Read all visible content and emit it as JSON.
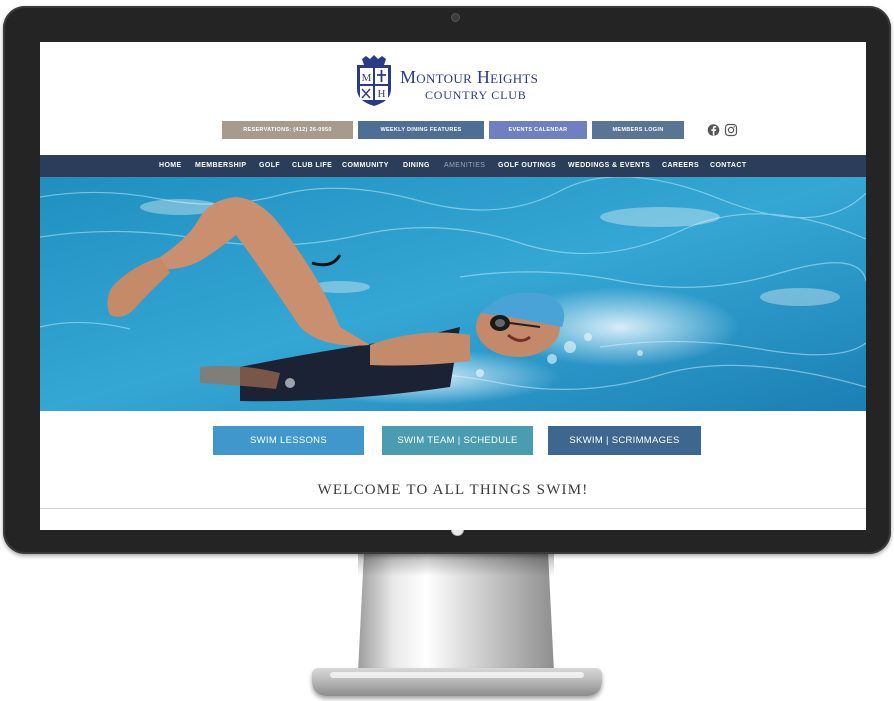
{
  "club": {
    "crest_letters": [
      "M",
      "H"
    ],
    "name_line1": "Montour Heights",
    "name_line2": "COUNTRY CLUB"
  },
  "top_buttons": [
    {
      "label": "RESERVATIONS: (412) 26-0950",
      "color": "#a89a8c"
    },
    {
      "label": "WEEKLY DINING FEATURES",
      "color": "#4f6e96"
    },
    {
      "label": "EVENTS CALENDAR",
      "color": "#6f7fbf"
    },
    {
      "label": "MEMBERS LOGIN",
      "color": "#5a7494"
    }
  ],
  "social": {
    "facebook": "facebook-icon",
    "instagram": "instagram-icon"
  },
  "nav": {
    "items": [
      "HOME",
      "MEMBERSHIP",
      "GOLF",
      "CLUB LIFE",
      "COMMUNITY",
      "DINING",
      "AMENITIES",
      "GOLF OUTINGS",
      "WEDDINGS & EVENTS",
      "CAREERS",
      "CONTACT"
    ],
    "active": "AMENITIES",
    "background": "#2b3d59"
  },
  "hero": {
    "subject": "swimmer-photo"
  },
  "cta_buttons": [
    {
      "label": "SWIM LESSONS",
      "color": "#3f97cc"
    },
    {
      "label": "SWIM TEAM  |  SCHEDULE",
      "color": "#4a9db0"
    },
    {
      "label": "SKWIM  |  SCRIMMAGES",
      "color": "#3e6790"
    }
  ],
  "welcome": "WELCOME TO ALL THINGS SWIM!"
}
